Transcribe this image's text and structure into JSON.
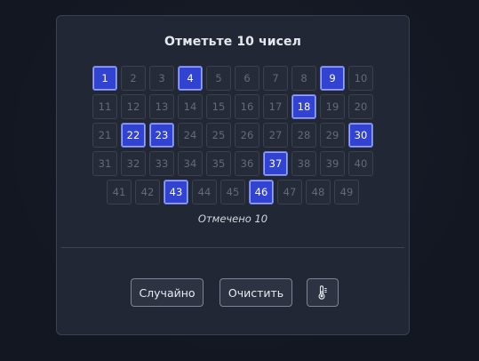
{
  "card": {
    "title": "Отметьте 10 чисел",
    "status": "Отмечено 10"
  },
  "grid": {
    "rows": [
      [
        1,
        2,
        3,
        4,
        5,
        6,
        7,
        8,
        9,
        10
      ],
      [
        11,
        12,
        13,
        14,
        15,
        16,
        17,
        18,
        19,
        20
      ],
      [
        21,
        22,
        23,
        24,
        25,
        26,
        27,
        28,
        29,
        30
      ],
      [
        31,
        32,
        33,
        34,
        35,
        36,
        37,
        38,
        39,
        40
      ],
      [
        41,
        42,
        43,
        44,
        45,
        46,
        47,
        48,
        49
      ]
    ],
    "selected": [
      1,
      4,
      9,
      18,
      22,
      23,
      30,
      37,
      43,
      46
    ]
  },
  "buttons": {
    "random_label": "Случайно",
    "clear_label": "Очистить",
    "extra_icon": "thermometer-icon"
  },
  "colors": {
    "selected_bg": "#3343d1",
    "cell_bg": "#262b38",
    "card_bg": "#222735"
  }
}
